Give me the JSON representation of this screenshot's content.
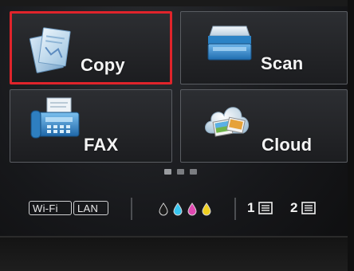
{
  "menu": {
    "tiles": [
      {
        "label": "Copy",
        "icon": "copy-icon",
        "selected": true
      },
      {
        "label": "Scan",
        "icon": "scan-icon",
        "selected": false
      },
      {
        "label": "FAX",
        "icon": "fax-icon",
        "selected": false
      },
      {
        "label": "Cloud",
        "icon": "cloud-icon",
        "selected": false
      }
    ],
    "selection_color": "#e0242b",
    "page_indicator": {
      "pages": 3,
      "current": 1
    }
  },
  "status": {
    "network": [
      {
        "label": "Wi-Fi",
        "icon": "wifi-status"
      },
      {
        "label": "LAN",
        "icon": "lan-status"
      }
    ],
    "ink": {
      "icon": "ink-level-icon",
      "colors": [
        "#1c1c1c",
        "#38c6f0",
        "#e048b0",
        "#f0d020"
      ]
    },
    "trays": [
      {
        "number": "1",
        "icon": "paper-tray-icon"
      },
      {
        "number": "2",
        "icon": "paper-tray-icon"
      }
    ]
  }
}
